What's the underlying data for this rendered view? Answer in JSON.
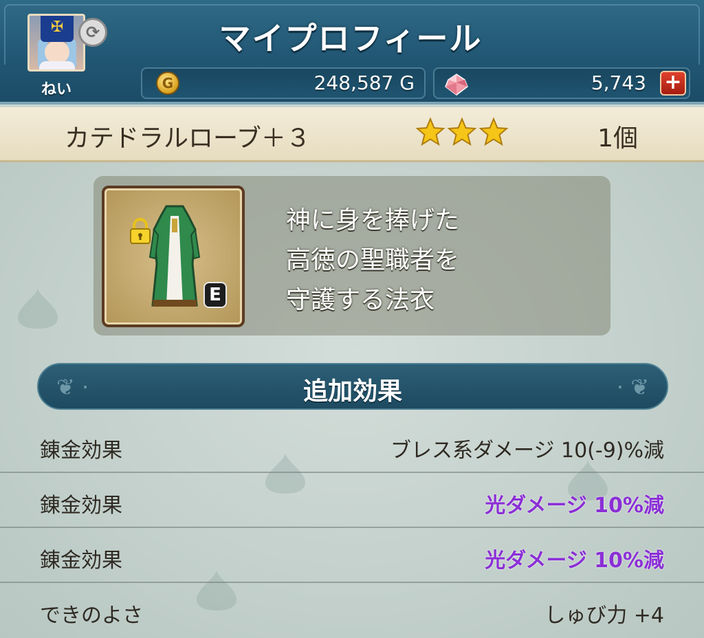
{
  "header": {
    "title": "マイプロフィール",
    "player_name": "ねい",
    "gold": "248,587 G",
    "gems": "5,743"
  },
  "item": {
    "name": "カテドラルローブ＋３",
    "stars": 3,
    "count": "1個",
    "equip_badge": "E",
    "description": [
      "神に身を捧げた",
      "高徳の聖職者を",
      "守護する法衣"
    ]
  },
  "bonus": {
    "title": "追加効果",
    "rows": [
      {
        "label": "錬金効果",
        "value": "ブレス系ダメージ  10(-9)%減",
        "highlight": false
      },
      {
        "label": "錬金効果",
        "value": "光ダメージ  10%減",
        "highlight": true
      },
      {
        "label": "錬金効果",
        "value": "光ダメージ  10%減",
        "highlight": true
      },
      {
        "label": "できのよさ",
        "value": "しゅび力  +4",
        "highlight": false
      }
    ]
  },
  "colors": {
    "header_blue": "#215673",
    "highlight_purple": "#8b2fd6",
    "star_gold": "#f5c518"
  },
  "icons": [
    "gold-coin-icon",
    "gem-icon",
    "plus-icon",
    "swap-icon",
    "lock-icon",
    "robe-icon",
    "star-icon"
  ]
}
